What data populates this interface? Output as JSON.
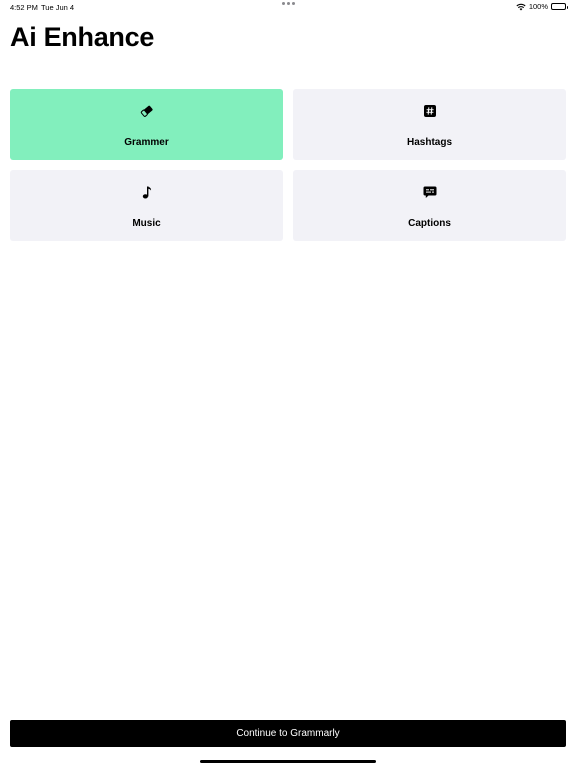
{
  "status_bar": {
    "time": "4:52 PM",
    "date": "Tue Jun 4",
    "battery": "100%"
  },
  "header": {
    "title": "Ai Enhance"
  },
  "tiles": [
    {
      "label": "Grammer",
      "icon": "eraser-icon",
      "selected": true
    },
    {
      "label": "Hashtags",
      "icon": "hashtag-icon",
      "selected": false
    },
    {
      "label": "Music",
      "icon": "music-note-icon",
      "selected": false
    },
    {
      "label": "Captions",
      "icon": "caption-bubble-icon",
      "selected": false
    }
  ],
  "footer": {
    "continue_label": "Continue to Grammarly"
  },
  "colors": {
    "selected_tile": "#82efbd",
    "tile_background": "#f2f2f7",
    "button_background": "#000000",
    "button_text": "#ffffff"
  }
}
